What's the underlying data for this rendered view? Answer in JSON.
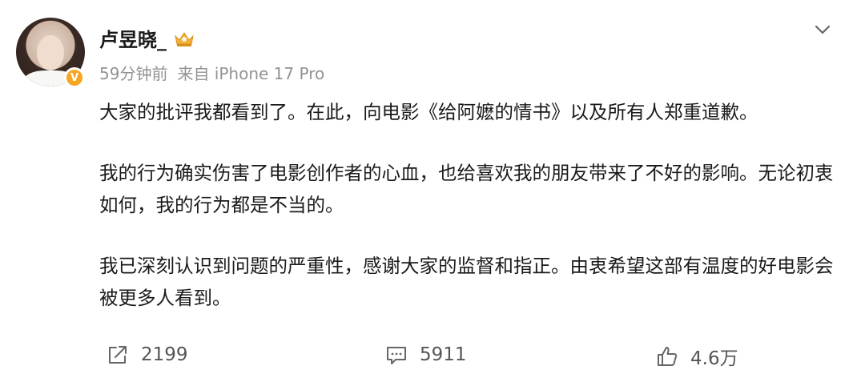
{
  "post": {
    "author": "卢昱晓_",
    "time": "59分钟前",
    "source": "来自 iPhone 17 Pro",
    "paragraphs": [
      "大家的批评我都看到了。在此，向电影《给阿嬷的情书》以及所有人郑重道歉。",
      "我的行为确实伤害了电影创作者的心血，也给喜欢我的朋友带来了不好的影响。无论初衷如何，我的行为都是不当的。",
      "我已深刻认识到问题的严重性，感谢大家的监督和指正。由衷希望这部有温度的好电影会被更多人看到。"
    ],
    "verified_badge": "V",
    "icons": {
      "menu": "chevron-down-icon",
      "repost": "repost-icon",
      "comment": "comment-icon",
      "like": "like-icon",
      "crown": "crown-icon"
    }
  },
  "actions": {
    "reposts": "2199",
    "comments": "5911",
    "likes": "4.6万"
  },
  "colors": {
    "verified": "#f6a623",
    "meta": "#939393",
    "action": "#555555"
  }
}
